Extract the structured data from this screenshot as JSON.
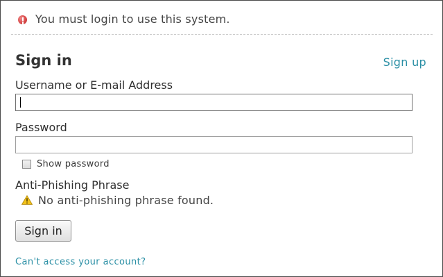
{
  "alert": {
    "icon": "error-icon",
    "message": "You must login to use this system."
  },
  "heading": "Sign in",
  "signup_link": "Sign up",
  "username": {
    "label": "Username or E-mail Address",
    "value": ""
  },
  "password": {
    "label": "Password",
    "value": ""
  },
  "show_password": {
    "label": "Show password",
    "checked": false
  },
  "anti_phishing": {
    "label": "Anti-Phishing Phrase",
    "icon": "warning-icon",
    "message": "No anti-phishing phrase found."
  },
  "signin_button": "Sign in",
  "cant_access_link": "Can't access your account?",
  "colors": {
    "link": "#2a8fa5",
    "error": "#d64545",
    "warning": "#f2c21b"
  }
}
